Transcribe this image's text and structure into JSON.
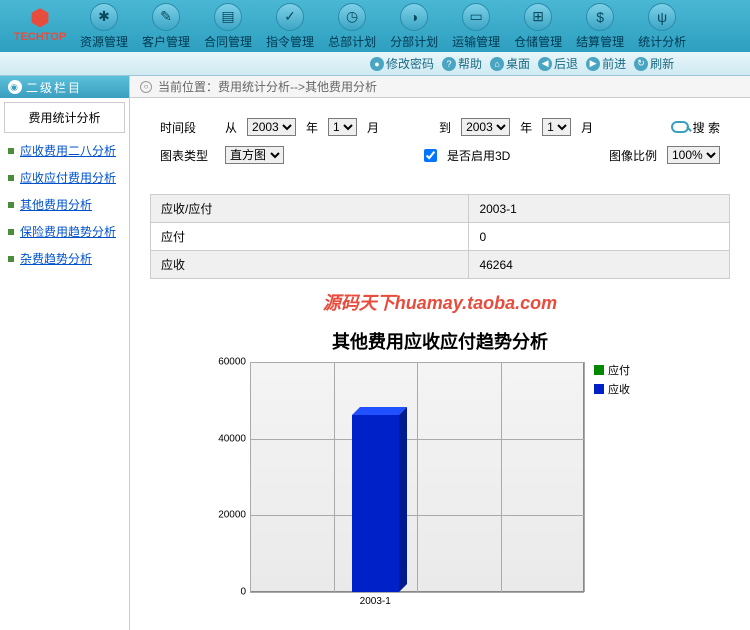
{
  "topnav": [
    {
      "label": "资源管理",
      "icon": "✱"
    },
    {
      "label": "客户管理",
      "icon": "✎"
    },
    {
      "label": "合同管理",
      "icon": "▤"
    },
    {
      "label": "指令管理",
      "icon": "✓"
    },
    {
      "label": "总部计划",
      "icon": "◷"
    },
    {
      "label": "分部计划",
      "icon": "◑"
    },
    {
      "label": "运输管理",
      "icon": "▭"
    },
    {
      "label": "仓储管理",
      "icon": "⊞"
    },
    {
      "label": "结算管理",
      "icon": "$"
    },
    {
      "label": "统计分析",
      "icon": "ψ"
    }
  ],
  "toolbar": {
    "change_pwd": "修改密码",
    "help": "帮助",
    "desktop": "桌面",
    "back": "后退",
    "forward": "前进",
    "refresh": "刷新"
  },
  "sidebar": {
    "header": "二级栏目",
    "current": "费用统计分析",
    "links": [
      "应收费用二八分析",
      "应收应付费用分析",
      "其他费用分析",
      "保险费用趋势分析",
      "杂费趋势分析"
    ]
  },
  "breadcrumb": {
    "prefix": "当前位置：",
    "part1": "费用统计分析",
    "arrow": " --> ",
    "part2": "其他费用分析"
  },
  "form": {
    "time_label": "时间段",
    "from": "从",
    "year": "年",
    "month": "月",
    "to": "到",
    "year_from": "2003",
    "month_from": "1",
    "year_to": "2003",
    "month_to": "1",
    "search": "搜 索",
    "chart_type_label": "图表类型",
    "chart_type": "直方图",
    "enable3d": "是否启用3D",
    "ratio_label": "图像比例",
    "ratio": "100%"
  },
  "table": {
    "rows": [
      [
        "应收/应付",
        "2003-1"
      ],
      [
        "应付",
        "0"
      ],
      [
        "应收",
        "46264"
      ]
    ]
  },
  "watermark": "源码天下huamay.taoba.com",
  "chart_data": {
    "type": "bar",
    "title": "其他费用应收应付趋势分析",
    "categories": [
      "2003-1"
    ],
    "series": [
      {
        "name": "应付",
        "values": [
          0
        ],
        "color": "#008800"
      },
      {
        "name": "应收",
        "values": [
          46264
        ],
        "color": "#0020c8"
      }
    ],
    "ylim": [
      0,
      60000
    ],
    "yticks": [
      0,
      20000,
      40000,
      60000
    ]
  }
}
